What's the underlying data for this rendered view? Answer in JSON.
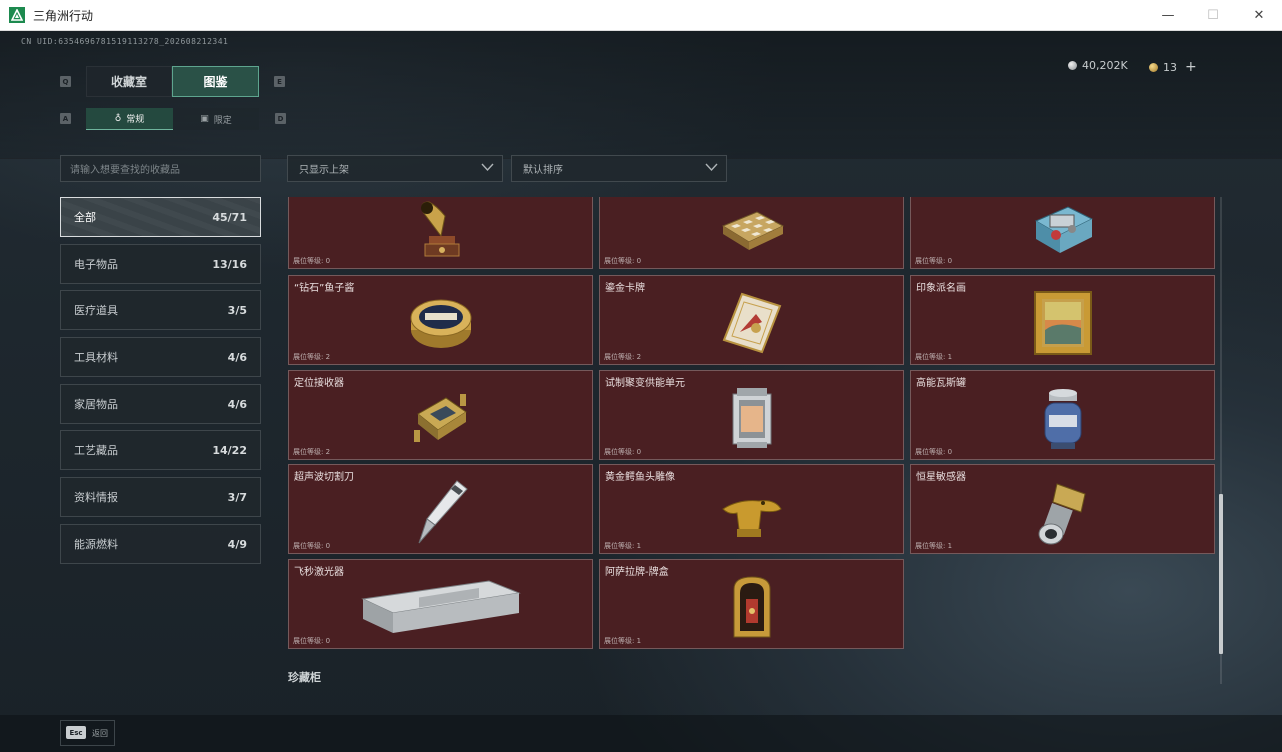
{
  "window": {
    "title": "三角洲行动",
    "minimize": "—",
    "maximize": "☐",
    "close": "✕"
  },
  "header": {
    "uid": "CN UID:6354696781519113278_202608212341",
    "currency_silver": "40,202K",
    "currency_gold": "13",
    "add": "+"
  },
  "hotkeys": {
    "q": "Q",
    "e": "E",
    "a": "A",
    "d": "D"
  },
  "tabs": [
    {
      "label": "收藏室"
    },
    {
      "label": "图鉴"
    }
  ],
  "subtabs": [
    {
      "label": "常规"
    },
    {
      "label": "限定"
    }
  ],
  "search": {
    "placeholder": "请输入想要查找的收藏品"
  },
  "filters": {
    "shelf": "只显示上架",
    "sort": "默认排序"
  },
  "categories": [
    {
      "label": "全部",
      "count": "45/71"
    },
    {
      "label": "电子物品",
      "count": "13/16"
    },
    {
      "label": "医疗道具",
      "count": "3/5"
    },
    {
      "label": "工具材料",
      "count": "4/6"
    },
    {
      "label": "家居物品",
      "count": "4/6"
    },
    {
      "label": "工艺藏品",
      "count": "14/22"
    },
    {
      "label": "资料情报",
      "count": "3/7"
    },
    {
      "label": "能源燃料",
      "count": "4/9"
    }
  ],
  "items": [
    {
      "name": "",
      "level": "展位等级: 0",
      "icon": "gramophone-icon"
    },
    {
      "name": "",
      "level": "展位等级: 0",
      "icon": "chessboard-icon"
    },
    {
      "name": "",
      "level": "展位等级: 0",
      "icon": "device-icon"
    },
    {
      "name": "“钻石”鱼子酱",
      "level": "展位等级: 2",
      "icon": "caviar-tin-icon"
    },
    {
      "name": "鎏金卡牌",
      "level": "展位等级: 2",
      "icon": "gold-card-icon"
    },
    {
      "name": "印象派名画",
      "level": "展位等级: 1",
      "icon": "painting-icon"
    },
    {
      "name": "定位接收器",
      "level": "展位等级: 2",
      "icon": "receiver-icon"
    },
    {
      "name": "试制聚变供能单元",
      "level": "展位等级: 0",
      "icon": "fusion-unit-icon"
    },
    {
      "name": "高能瓦斯罐",
      "level": "展位等级: 0",
      "icon": "gas-canister-icon"
    },
    {
      "name": "超声波切割刀",
      "level": "展位等级: 0",
      "icon": "ultrasonic-knife-icon"
    },
    {
      "name": "黄金鳄鱼头雕像",
      "level": "展位等级: 1",
      "icon": "gold-crocodile-icon"
    },
    {
      "name": "恒星敏感器",
      "level": "展位等级: 1",
      "icon": "star-sensor-icon"
    },
    {
      "name": "飞秒激光器",
      "level": "展位等级: 0",
      "icon": "femtosecond-laser-icon"
    },
    {
      "name": "阿萨拉牌-牌盒",
      "level": "展位等级: 1",
      "icon": "card-box-icon"
    }
  ],
  "section": {
    "title": "珍藏柜"
  },
  "footer": {
    "esc": "Esc",
    "back": "返回"
  },
  "colors": {
    "card_bg": "#4a1f22",
    "accent": "#5ea58f",
    "tab_active": "#2a5147"
  }
}
